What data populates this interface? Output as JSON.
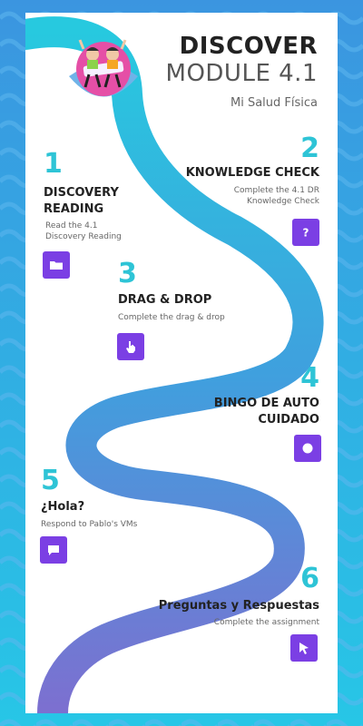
{
  "header": {
    "title_line1": "DISCOVER",
    "title_line2": "MODULE 4.1",
    "subtitle": "Mi Salud Física"
  },
  "steps": [
    {
      "number": "1",
      "title": "DISCOVERY READING",
      "description": "Read the 4.1 Discovery Reading",
      "icon": "folder-icon"
    },
    {
      "number": "2",
      "title": "KNOWLEDGE CHECK",
      "description": "Complete the 4.1 DR Knowledge Check",
      "icon": "question-icon"
    },
    {
      "number": "3",
      "title": "DRAG & DROP",
      "description": "Complete the drag & drop",
      "icon": "hand-pointer-icon"
    },
    {
      "number": "4",
      "title": "BINGO DE AUTO CUIDADO",
      "description": "",
      "icon": "circle-icon"
    },
    {
      "number": "5",
      "title": "¿Hola?",
      "description": "Respond to Pablo's VMs",
      "icon": "chat-bubble-icon"
    },
    {
      "number": "6",
      "title": "Preguntas y Respuestas",
      "description": "Complete the assignment",
      "icon": "cursor-arrow-icon"
    }
  ],
  "colors": {
    "accent": "#7b3fe4",
    "number": "#2ec4d6",
    "path_top": "#27c9df",
    "path_bottom": "#7d6fd0",
    "background": "#2fb9e6"
  }
}
